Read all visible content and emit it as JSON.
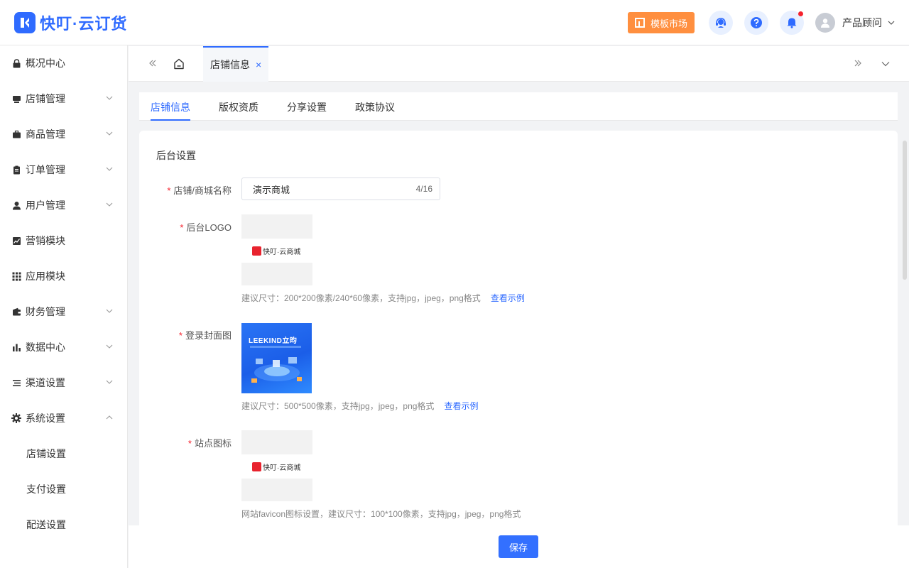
{
  "header": {
    "brand": "快叮·云订货",
    "market_button": "模板市场",
    "user_name": "产品顾问"
  },
  "sidebar": {
    "items": [
      {
        "label": "概况中心",
        "icon": "lock-icon",
        "has_arrow": false
      },
      {
        "label": "店铺管理",
        "icon": "store-icon",
        "has_arrow": true
      },
      {
        "label": "商品管理",
        "icon": "briefcase-icon",
        "has_arrow": true
      },
      {
        "label": "订单管理",
        "icon": "clipboard-icon",
        "has_arrow": true
      },
      {
        "label": "用户管理",
        "icon": "user-icon",
        "has_arrow": true
      },
      {
        "label": "营销模块",
        "icon": "chart-line-icon",
        "has_arrow": false
      },
      {
        "label": "应用模块",
        "icon": "grid-icon",
        "has_arrow": false
      },
      {
        "label": "财务管理",
        "icon": "wallet-icon",
        "has_arrow": true
      },
      {
        "label": "数据中心",
        "icon": "bar-chart-icon",
        "has_arrow": true
      },
      {
        "label": "渠道设置",
        "icon": "list-icon",
        "has_arrow": true
      },
      {
        "label": "系统设置",
        "icon": "gear-icon",
        "has_arrow": true,
        "expanded": true
      }
    ],
    "sub_items": [
      "店铺设置",
      "支付设置",
      "配送设置"
    ]
  },
  "tabbar": {
    "active_tab": "店铺信息",
    "close_symbol": "×"
  },
  "subtabs": [
    "店铺信息",
    "版权资质",
    "分享设置",
    "政策协议"
  ],
  "form": {
    "section_title": "后台设置",
    "required_mark": "*",
    "name_label": "店铺/商城名称",
    "name_value": "演示商城",
    "name_counter": "4/16",
    "logo_label": "后台LOGO",
    "logo_text": "快叮·云商城",
    "logo_hint": "建议尺寸：200*200像素/240*60像素，支持jpg，jpeg，png格式",
    "view_example": "查看示例",
    "cover_label": "登录封面图",
    "cover_title": "LEEKIND立昀",
    "cover_hint": "建议尺寸：500*500像素，支持jpg，jpeg，png格式",
    "favicon_label": "站点图标",
    "favicon_text": "快叮·云商城",
    "favicon_hint": "网站favicon图标设置，建议尺寸：100*100像素，支持jpg，jpeg，png格式"
  },
  "save_button": "保存",
  "colors": {
    "primary": "#2f6bff",
    "market": "#ff8f3f",
    "required": "#f5222d"
  }
}
